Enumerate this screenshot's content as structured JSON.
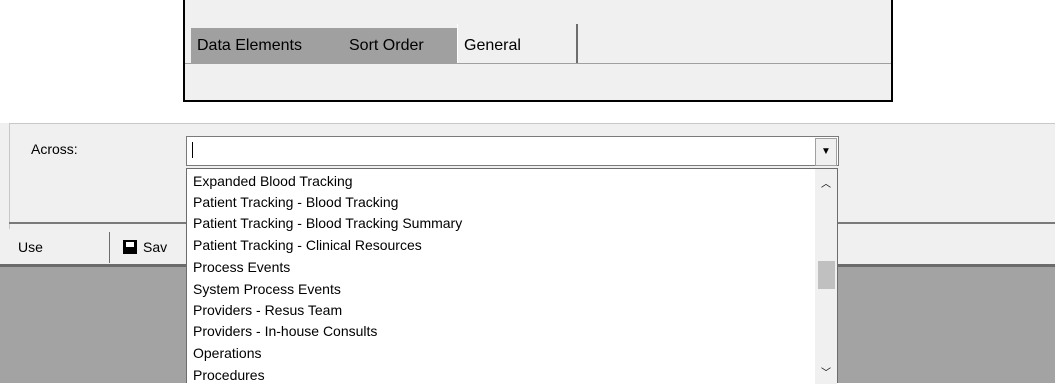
{
  "tabs": {
    "data_elements": "Data Elements",
    "sort_order": "Sort Order",
    "general": "General"
  },
  "form": {
    "across_label": "Across:",
    "across_value": ""
  },
  "toolbar": {
    "use_label": "Use",
    "save_label": "Sav"
  },
  "dropdown": {
    "items": [
      "Expanded Blood Tracking",
      "Patient Tracking - Blood Tracking",
      "Patient Tracking - Blood Tracking Summary",
      "Patient Tracking - Clinical Resources",
      "Process Events",
      "System Process Events",
      "Providers - Resus Team",
      "Providers - In-house Consults",
      "Operations",
      "Procedures"
    ]
  },
  "icons": {
    "combo_arrow": "chevron-down-icon",
    "scroll_up": "chevron-up-icon",
    "scroll_down": "chevron-down-icon",
    "save": "floppy-disk-icon"
  }
}
